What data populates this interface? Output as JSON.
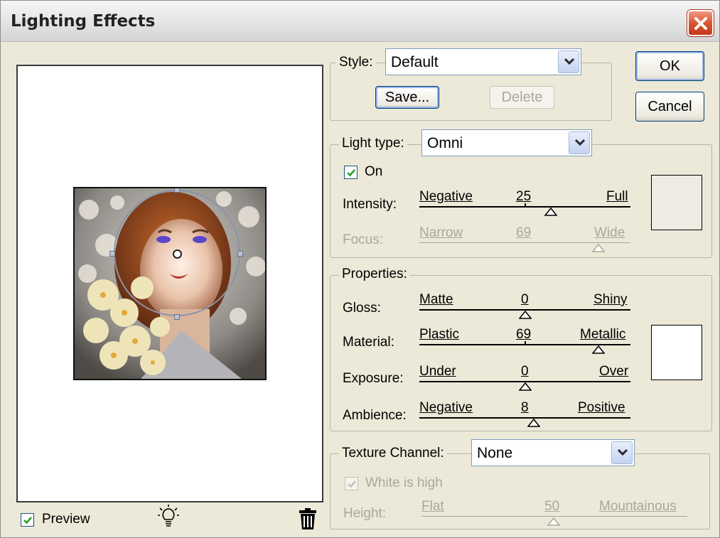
{
  "window": {
    "title": "Lighting Effects"
  },
  "buttons": {
    "ok": "OK",
    "cancel": "Cancel",
    "save": "Save...",
    "delete": "Delete"
  },
  "style": {
    "label": "Style:",
    "value": "Default"
  },
  "light": {
    "type_label": "Light type:",
    "type_value": "Omni",
    "on_label": "On",
    "on_checked": true,
    "intensity": {
      "label": "Intensity:",
      "min": "Negative",
      "max": "Full",
      "value": "25"
    },
    "focus": {
      "label": "Focus:",
      "min": "Narrow",
      "max": "Wide",
      "value": "69",
      "disabled": true
    },
    "color": "#efeae2"
  },
  "properties": {
    "legend": "Properties:",
    "gloss": {
      "label": "Gloss:",
      "min": "Matte",
      "max": "Shiny",
      "value": "0"
    },
    "material": {
      "label": "Material:",
      "min": "Plastic",
      "max": "Metallic",
      "value": "69"
    },
    "exposure": {
      "label": "Exposure:",
      "min": "Under",
      "max": "Over",
      "value": "0"
    },
    "ambience": {
      "label": "Ambience:",
      "min": "Negative",
      "max": "Positive",
      "value": "8"
    },
    "color": "#ffffff"
  },
  "texture": {
    "label": "Texture Channel:",
    "value": "None",
    "white_is_high": "White is high",
    "height": {
      "label": "Height:",
      "min": "Flat",
      "max": "Mountainous",
      "value": "50"
    }
  },
  "preview": {
    "label": "Preview",
    "checked": true
  },
  "icons": {
    "light_bulb": "light-bulb-icon",
    "trash": "trash-icon",
    "close": "close-icon"
  }
}
